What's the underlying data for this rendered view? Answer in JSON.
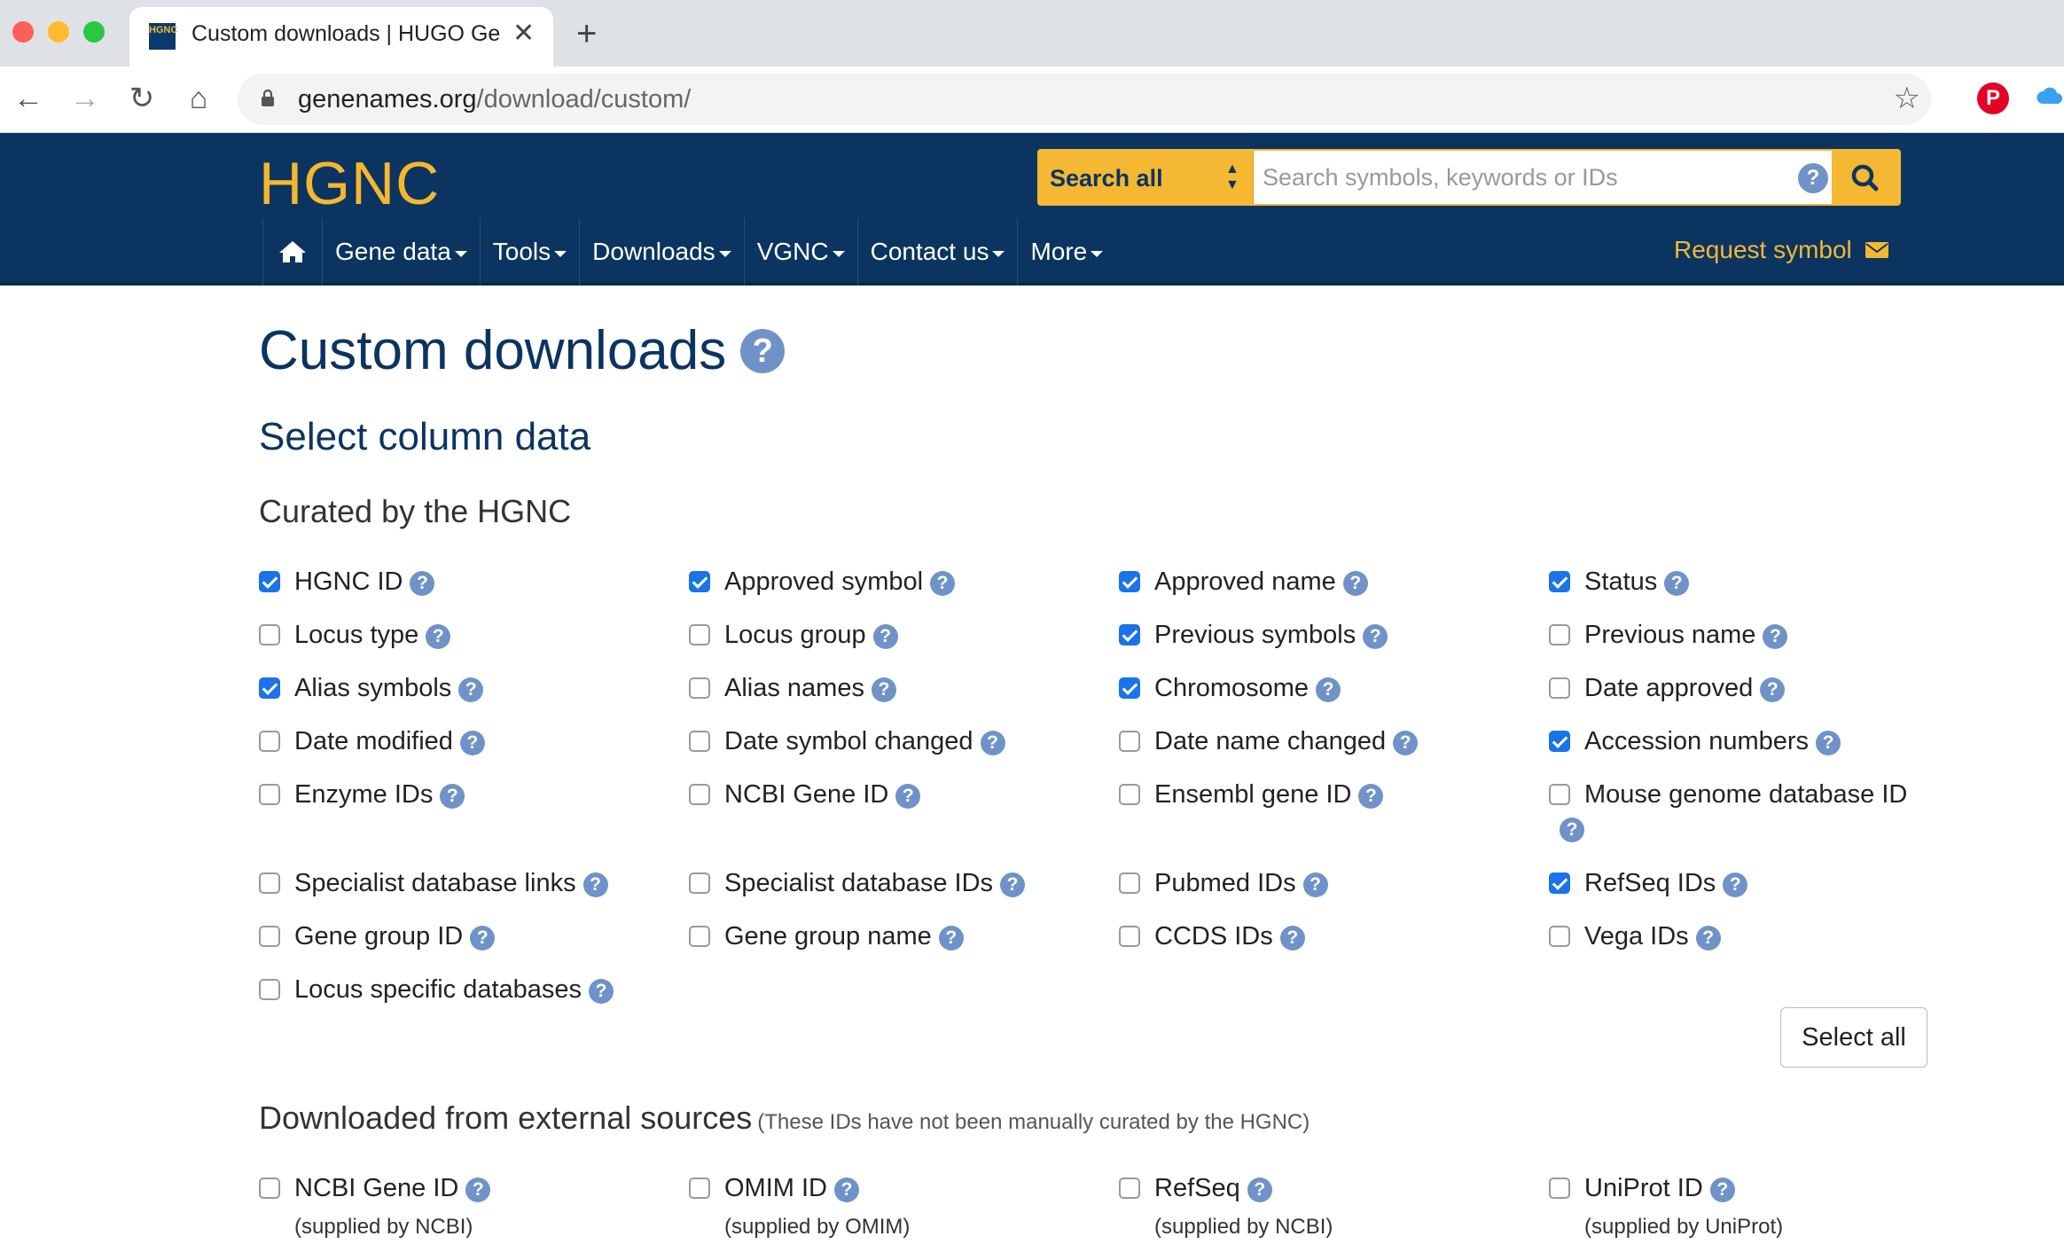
{
  "browser": {
    "tab_title": "Custom downloads | HUGO Gene Nomenclature Committee",
    "favicon_text": "HGNC",
    "url_host": "genenames.org",
    "url_path": "/download/custom/"
  },
  "site": {
    "logo": "HGNC",
    "search_scope": "Search all",
    "search_placeholder": "Search symbols, keywords or IDs",
    "nav": [
      "Gene data",
      "Tools",
      "Downloads",
      "VGNC",
      "Contact us",
      "More"
    ],
    "request_symbol": "Request symbol"
  },
  "page": {
    "title": "Custom downloads",
    "section_title": "Select column data",
    "curated_heading": "Curated by the HGNC",
    "select_all": "Select all",
    "external_heading": "Downloaded from external sources",
    "external_note": "(These IDs have not been manually curated by the HGNC)"
  },
  "curated_options": [
    {
      "label": "HGNC ID",
      "checked": true
    },
    {
      "label": "Approved symbol",
      "checked": true
    },
    {
      "label": "Approved name",
      "checked": true
    },
    {
      "label": "Status",
      "checked": true
    },
    {
      "label": "Locus type",
      "checked": false
    },
    {
      "label": "Locus group",
      "checked": false
    },
    {
      "label": "Previous symbols",
      "checked": true
    },
    {
      "label": "Previous name",
      "checked": false
    },
    {
      "label": "Alias symbols",
      "checked": true
    },
    {
      "label": "Alias names",
      "checked": false
    },
    {
      "label": "Chromosome",
      "checked": true
    },
    {
      "label": "Date approved",
      "checked": false
    },
    {
      "label": "Date modified",
      "checked": false
    },
    {
      "label": "Date symbol changed",
      "checked": false
    },
    {
      "label": "Date name changed",
      "checked": false
    },
    {
      "label": "Accession numbers",
      "checked": true
    },
    {
      "label": "Enzyme IDs",
      "checked": false
    },
    {
      "label": "NCBI Gene ID",
      "checked": false
    },
    {
      "label": "Ensembl gene ID",
      "checked": false
    },
    {
      "label": "Mouse genome database ID",
      "checked": false
    },
    {
      "label": "Specialist database links",
      "checked": false
    },
    {
      "label": "Specialist database IDs",
      "checked": false
    },
    {
      "label": "Pubmed IDs",
      "checked": false
    },
    {
      "label": "RefSeq IDs",
      "checked": true
    },
    {
      "label": "Gene group ID",
      "checked": false
    },
    {
      "label": "Gene group name",
      "checked": false
    },
    {
      "label": "CCDS IDs",
      "checked": false
    },
    {
      "label": "Vega IDs",
      "checked": false
    },
    {
      "label": "Locus specific databases",
      "checked": false
    }
  ],
  "external_options": [
    {
      "label": "NCBI Gene ID",
      "sub": "(supplied by NCBI)",
      "checked": false
    },
    {
      "label": "OMIM ID",
      "sub": "(supplied by OMIM)",
      "checked": false
    },
    {
      "label": "RefSeq",
      "sub": "(supplied by NCBI)",
      "checked": false
    },
    {
      "label": "UniProt ID",
      "sub": "(supplied by UniProt)",
      "checked": false
    }
  ],
  "colors": {
    "header_bg": "#0b3461",
    "accent": "#f4b833",
    "help_icon": "#6f93c8",
    "checkbox_on": "#1a73e8"
  }
}
